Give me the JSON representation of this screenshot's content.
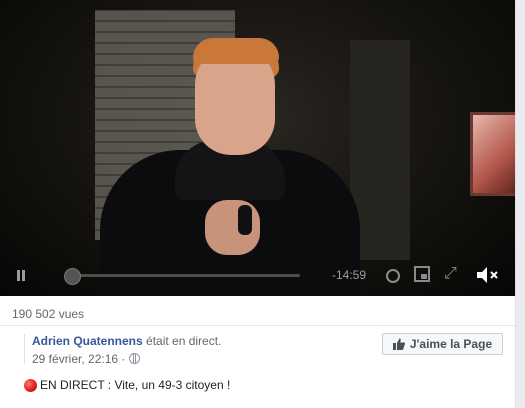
{
  "video": {
    "time_remaining": "-14:59",
    "progress_fraction": 0.0
  },
  "post": {
    "views": "190 502 vues",
    "author_name": "Adrien Quatennens",
    "author_status": " était en direct.",
    "timestamp": "29 février, 22:16",
    "meta_separator": " · ",
    "like_page_label": "J'aime la Page",
    "text_prefix": " EN DIRECT : Vite, un 49-3 citoyen !"
  },
  "icons": {
    "pause": "pause-icon",
    "settings": "settings-icon",
    "theater": "theater-mode-icon",
    "fullscreen": "fullscreen-icon",
    "volume": "volume-muted-icon",
    "globe": "globe-icon",
    "thumb": "thumbs-up-icon",
    "live_dot": "red-circle-icon"
  },
  "colors": {
    "author_link": "#365899",
    "live_red": "#e0201a"
  }
}
